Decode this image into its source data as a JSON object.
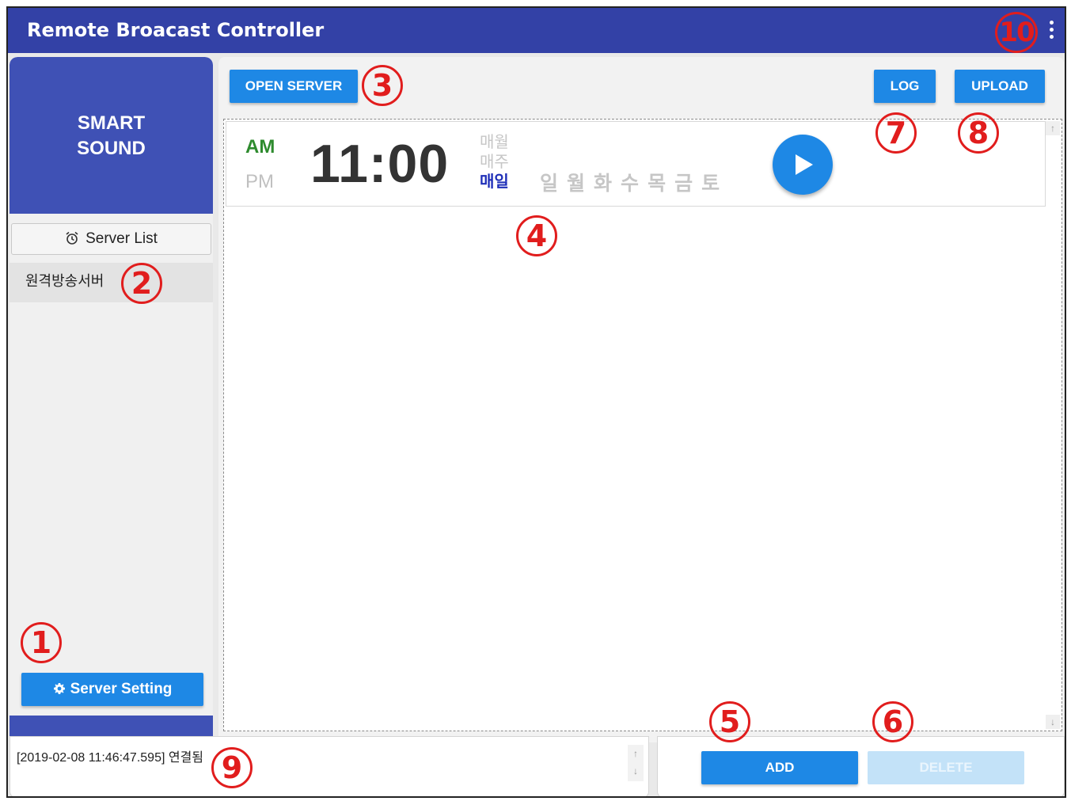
{
  "app": {
    "title": "Remote Broacast Controller"
  },
  "sidebar": {
    "brand_line1": "SMART",
    "brand_line2": "SOUND",
    "server_list_label": "Server List",
    "servers": [
      "원격방송서버"
    ],
    "setting_label": "Server Setting"
  },
  "toolbar": {
    "open_server_label": "OPEN SERVER",
    "log_label": "LOG",
    "upload_label": "UPLOAD"
  },
  "schedule": {
    "am_label": "AM",
    "pm_label": "PM",
    "selected_period": "AM",
    "time": "11:00",
    "frequency_options": [
      "매월",
      "매주",
      "매일"
    ],
    "selected_frequency": "매일",
    "days": [
      "일",
      "월",
      "화",
      "수",
      "목",
      "금",
      "토"
    ]
  },
  "log": {
    "entry": "[2019-02-08 11:46:47.595] 연결됨"
  },
  "actions": {
    "add_label": "ADD",
    "delete_label": "DELETE"
  },
  "annotations": [
    "1",
    "2",
    "3",
    "4",
    "5",
    "6",
    "7",
    "8",
    "9",
    "10"
  ],
  "colors": {
    "titlebar": "#3341a6",
    "accent": "#1e88e5",
    "brand": "#3f51b5",
    "annotation": "#e11d1d",
    "am_active": "#2e8b2e",
    "freq_active": "#1f2fb8"
  }
}
